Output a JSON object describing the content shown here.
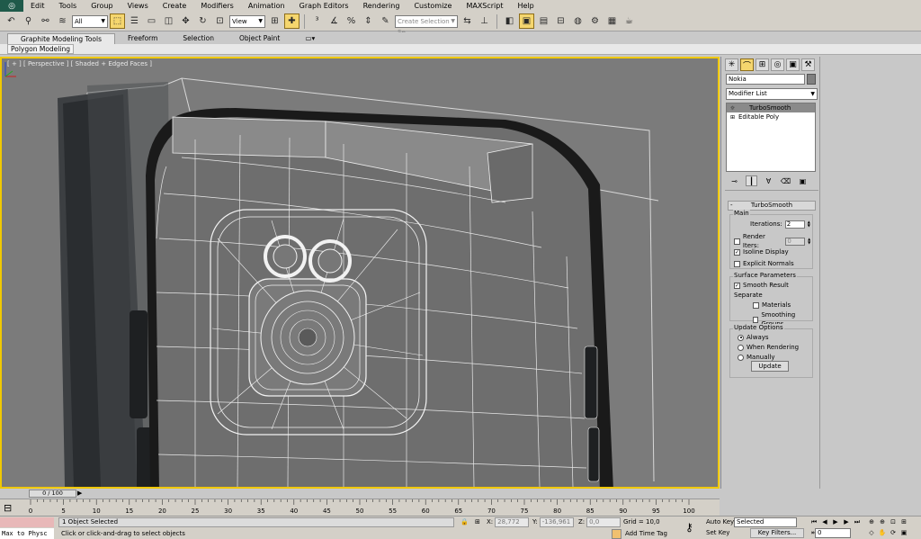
{
  "menu": {
    "items": [
      "Edit",
      "Tools",
      "Group",
      "Views",
      "Create",
      "Modifiers",
      "Animation",
      "Graph Editors",
      "Rendering",
      "Customize",
      "MAXScript",
      "Help"
    ]
  },
  "toolbar": {
    "selection_filter": "All",
    "reference_coord": "View",
    "named_selection_placeholder": "Create Selection Se"
  },
  "ribbon": {
    "tabs": [
      "Graphite Modeling Tools",
      "Freeform",
      "Selection",
      "Object Paint"
    ],
    "sub_panel": "Polygon Modeling"
  },
  "viewport": {
    "label": "[ + ] [ Perspective ] [ Shaded + Edged Faces ]"
  },
  "command_panel": {
    "object_name": "Nokia",
    "object_color": "#808080",
    "modifier_list": "Modifier List",
    "stack": [
      {
        "label": "TurboSmooth",
        "icon": "lightbulb-icon",
        "selected": true
      },
      {
        "label": "Editable Poly",
        "icon": "plus-box-icon",
        "selected": false
      }
    ],
    "rollout": {
      "title": "TurboSmooth",
      "main": {
        "title": "Main",
        "iterations_label": "Iterations:",
        "iterations_value": "2",
        "render_iters_label": "Render Iters:",
        "render_iters_value": "0",
        "isoline_display": "Isoline Display",
        "explicit_normals": "Explicit Normals"
      },
      "surface": {
        "title": "Surface Parameters",
        "smooth_result": "Smooth Result",
        "separate": "Separate",
        "materials": "Materials",
        "smoothing_groups": "Smoothing Groups"
      },
      "update_options": {
        "title": "Update Options",
        "always": "Always",
        "when_rendering": "When Rendering",
        "manually": "Manually",
        "update_button": "Update"
      }
    }
  },
  "timeline": {
    "slider": "0 / 100",
    "ticks": [
      "0",
      "5",
      "10",
      "15",
      "20",
      "25",
      "30",
      "35",
      "40",
      "45",
      "50",
      "55",
      "60",
      "65",
      "70",
      "75",
      "80",
      "85",
      "90",
      "95",
      "100"
    ]
  },
  "status": {
    "maxscript": "Max to Physc",
    "selected": "1 Object Selected",
    "prompt": "Click or click-and-drag to select objects",
    "x_label": "X:",
    "x_value": "28,772",
    "y_label": "Y:",
    "y_value": "-136,961",
    "z_label": "Z:",
    "z_value": "0,0",
    "grid": "Grid = 10,0",
    "add_time_tag": "Add Time Tag"
  },
  "anim": {
    "auto_key": "Auto Key",
    "auto_key_value": "Selected",
    "set_key": "Set Key",
    "key_filters": "Key Filters...",
    "frame": "0"
  }
}
